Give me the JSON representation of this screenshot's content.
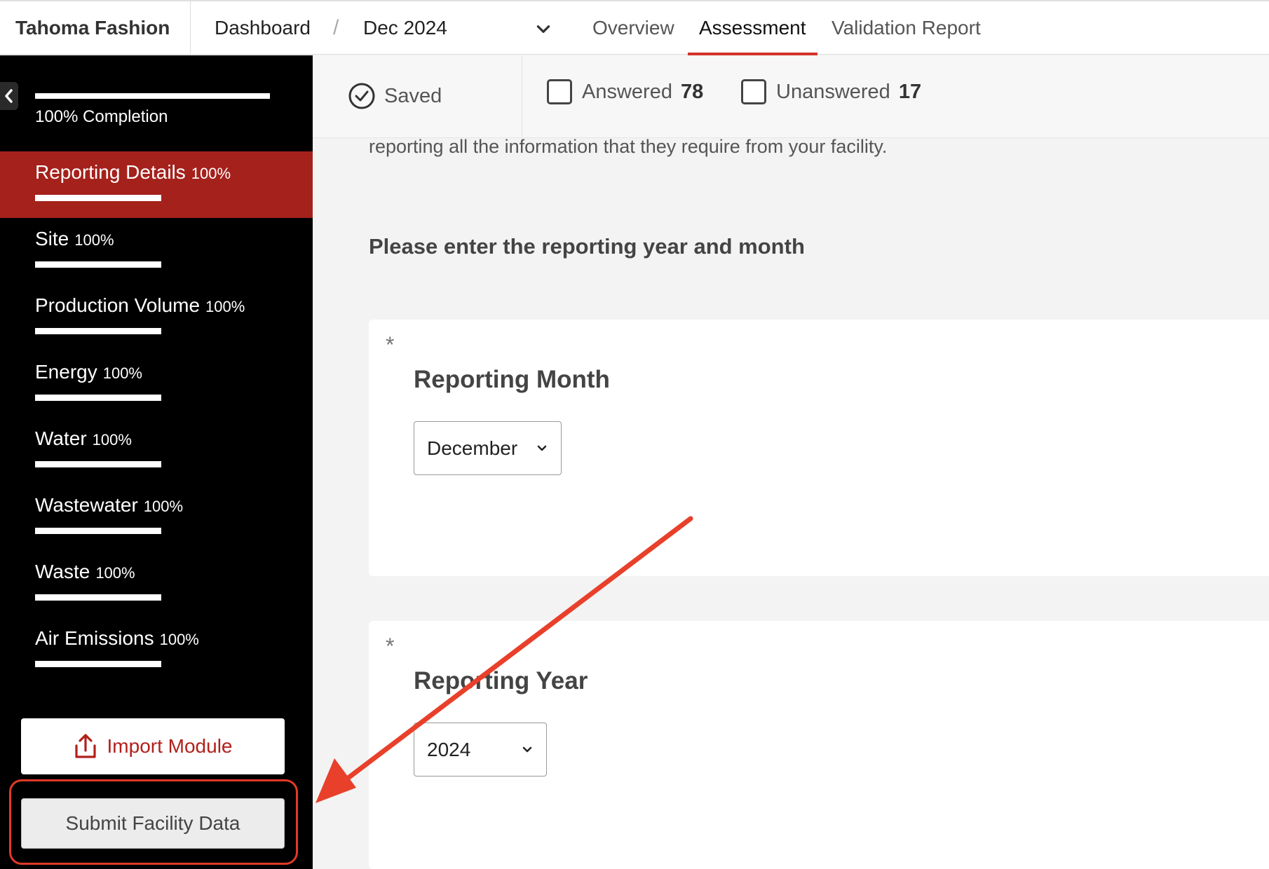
{
  "header": {
    "brand": "Tahoma Fashion",
    "breadcrumb": {
      "first": "Dashboard",
      "separator": "/",
      "period": "Dec 2024"
    },
    "tabs": [
      {
        "label": "Overview",
        "active": false
      },
      {
        "label": "Assessment",
        "active": true
      },
      {
        "label": "Validation Report",
        "active": false
      }
    ]
  },
  "sidebar": {
    "completion_label": "100% Completion",
    "completion_value": 100,
    "items": [
      {
        "label": "Reporting Details",
        "pct": "100%",
        "active": true
      },
      {
        "label": "Site",
        "pct": "100%"
      },
      {
        "label": "Production Volume",
        "pct": "100%"
      },
      {
        "label": "Energy",
        "pct": "100%"
      },
      {
        "label": "Water",
        "pct": "100%"
      },
      {
        "label": "Wastewater",
        "pct": "100%"
      },
      {
        "label": "Waste",
        "pct": "100%"
      },
      {
        "label": "Air Emissions",
        "pct": "100%"
      }
    ],
    "import_label": "Import Module",
    "submit_label": "Submit Facility Data"
  },
  "status": {
    "saved_label": "Saved",
    "answered_label": "Answered",
    "answered_count": "78",
    "unanswered_label": "Unanswered",
    "unanswered_count": "17"
  },
  "main": {
    "intro_text": "reporting all the information that they require from your facility.",
    "question_heading": "Please enter the reporting year and month",
    "required_mark": "*",
    "month_label": "Reporting Month",
    "month_value": "December",
    "year_label": "Reporting Year",
    "year_value": "2024"
  },
  "colors": {
    "accent_red": "#d4332a",
    "active_nav": "#a5211c",
    "annotation": "#e8402a"
  },
  "icons": [
    "chevron-down-icon",
    "chevron-left-icon",
    "check-circle-icon",
    "upload-icon",
    "annotation-arrow"
  ]
}
